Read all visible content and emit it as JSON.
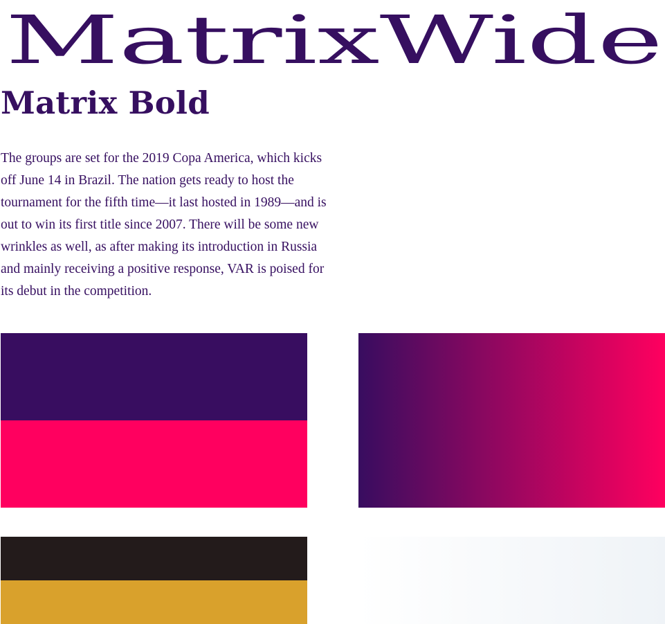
{
  "headline_wide": "MatrixWide",
  "headline_bold": "Matrix Bold",
  "body_paragraph": "The groups are set for the 2019 Copa America, which kicks off June 14 in Brazil. The nation gets ready to host the tournament for the fifth time—it last hosted in 1989—and is out to win its first title since 2007. There will be some new wrinkles as well, as after making its introduction in Russia and mainly receiving a positive response, VAR is poised for its debut in the competition.",
  "colors": {
    "text": "#360f60",
    "purple": "#380d60",
    "pink": "#ff005f",
    "dark": "#231b1b",
    "gold": "#d9a12c",
    "light_start": "#ffffff",
    "light_end": "#eff3f7"
  }
}
